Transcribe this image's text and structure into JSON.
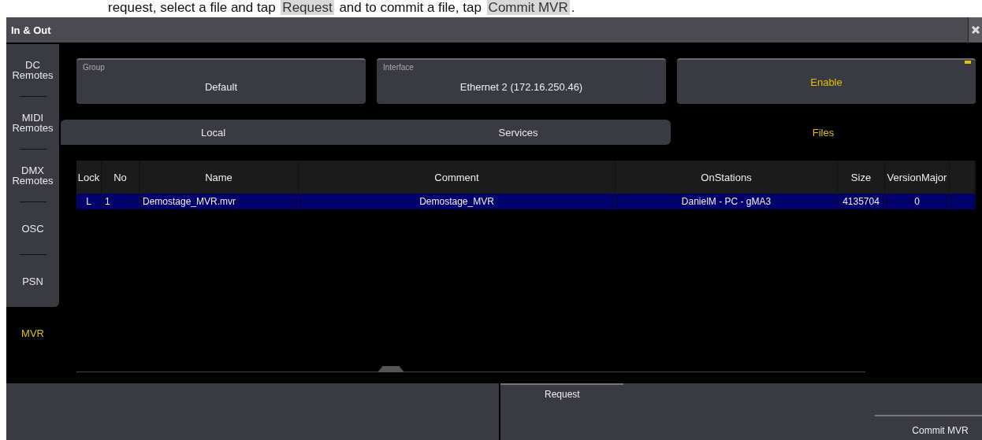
{
  "doc_caption": {
    "parts": [
      {
        "text": "request, select a file and tap ",
        "highlight": false
      },
      {
        "text": "Request",
        "highlight": true
      },
      {
        "text": " and to commit a file, tap ",
        "highlight": false
      },
      {
        "text": "Commit MVR",
        "highlight": true
      },
      {
        "text": ".",
        "highlight": false
      }
    ]
  },
  "window": {
    "title": "In & Out"
  },
  "sidebar": {
    "items": [
      {
        "label": "DC\nRemotes",
        "selected": false
      },
      {
        "label": "MIDI\nRemotes",
        "selected": false
      },
      {
        "label": "DMX\nRemotes",
        "selected": false
      },
      {
        "label": "OSC",
        "selected": false
      },
      {
        "label": "PSN",
        "selected": false
      },
      {
        "label": "MVR",
        "selected": true
      }
    ]
  },
  "settings": [
    {
      "kind": "field",
      "label": "Group",
      "value": "Default"
    },
    {
      "kind": "field",
      "label": "Interface",
      "value": "Ethernet 2 (172.16.250.46)"
    },
    {
      "kind": "toggle",
      "value": "Enable",
      "on": true
    }
  ],
  "tabs": [
    {
      "label": "Local",
      "selected": false
    },
    {
      "label": "Services",
      "selected": false
    },
    {
      "label": "Files",
      "selected": true
    }
  ],
  "table": {
    "columns": [
      "Lock",
      "No",
      "Name",
      "Comment",
      "OnStations",
      "Size",
      "VersionMajor"
    ],
    "rows": [
      {
        "cells": [
          "L",
          "1",
          "Demostage_MVR.mvr",
          "Demostage_MVR",
          "DanielM - PC - gMA3",
          "4135704",
          "0"
        ],
        "selected": true
      }
    ]
  },
  "actions": [
    "Request",
    "Commit MVR"
  ]
}
